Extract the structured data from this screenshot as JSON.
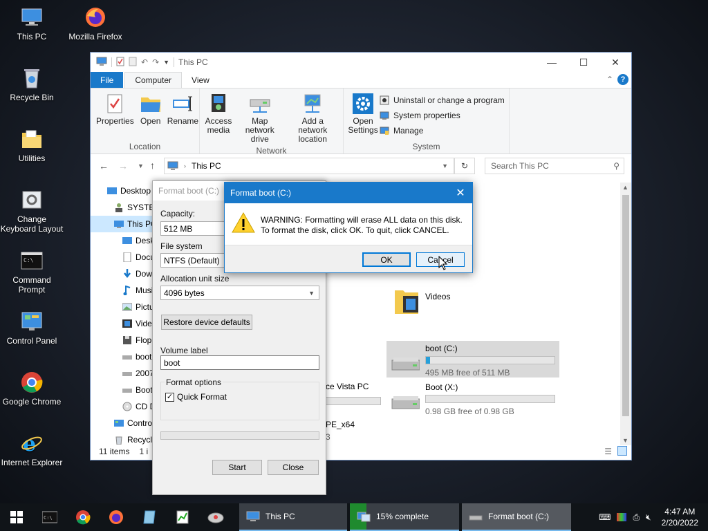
{
  "desktop": {
    "icons": [
      {
        "label": "This PC",
        "icon": "computer-icon"
      },
      {
        "label": "Mozilla Firefox",
        "icon": "firefox-icon"
      },
      {
        "label": "Recycle Bin",
        "icon": "recycle-bin-icon"
      },
      {
        "label": "Utilities",
        "icon": "folder-icon"
      },
      {
        "label": "Change Keyboard Layout",
        "icon": "keyboard-settings-icon"
      },
      {
        "label": "Command Prompt",
        "icon": "cmd-icon"
      },
      {
        "label": "Control Panel",
        "icon": "control-panel-icon"
      },
      {
        "label": "Google Chrome",
        "icon": "chrome-icon"
      },
      {
        "label": "Internet Explorer",
        "icon": "ie-icon"
      }
    ]
  },
  "explorer": {
    "title": "This PC",
    "tabs": {
      "file": "File",
      "computer": "Computer",
      "view": "View"
    },
    "ribbon": {
      "location": {
        "label": "Location",
        "properties": "Properties",
        "open": "Open",
        "rename": "Rename"
      },
      "network": {
        "label": "Network",
        "access_media": "Access media",
        "map_drive": "Map network drive",
        "add_location": "Add a network location"
      },
      "system": {
        "label": "System",
        "open_settings": "Open Settings",
        "uninstall": "Uninstall or change a program",
        "system_properties": "System properties",
        "manage": "Manage"
      }
    },
    "address": "This PC",
    "search_placeholder": "Search This PC",
    "tree": [
      "Desktop",
      "SYSTEM",
      "This PC",
      "Deskt",
      "Docu",
      "Down",
      "Music",
      "Pictur",
      "Video",
      "Flopp",
      "boot",
      "2007 l",
      "Boot",
      "CD Dr",
      "Contro",
      "Recycl"
    ],
    "status": {
      "items": "11 items",
      "selected": "1 i"
    },
    "content": {
      "videos": "Videos",
      "vista": "ce Vista PC",
      "pe": "PE_x64",
      "pe_sub": "3"
    },
    "drives": [
      {
        "name": "boot (C:)",
        "free": "495 MB free of 511 MB",
        "used_fraction": 0.03
      },
      {
        "name": "Boot (X:)",
        "free": "0.98 GB free of 0.98 GB",
        "used_fraction": 0.0
      }
    ]
  },
  "format": {
    "title": "Format boot (C:)",
    "capacity_label": "Capacity:",
    "capacity": "512 MB",
    "fs_label": "File system",
    "fs": "NTFS (Default)",
    "alloc_label": "Allocation unit size",
    "alloc": "4096 bytes",
    "restore": "Restore device defaults",
    "volume_label": "Volume label",
    "volume": "boot",
    "options_label": "Format options",
    "quick": "Quick Format",
    "start": "Start",
    "close": "Close"
  },
  "dialog": {
    "title": "Format boot (C:)",
    "line1": "WARNING: Formatting will erase ALL data on this disk.",
    "line2": "To format the disk, click OK. To quit, click CANCEL.",
    "ok": "OK",
    "cancel": "Cancel"
  },
  "taskbar": {
    "tasks": [
      "This PC",
      "15% complete",
      "Format boot (C:)"
    ],
    "time": "4:47 AM",
    "date": "2/20/2022",
    "progress_percent": 15
  }
}
